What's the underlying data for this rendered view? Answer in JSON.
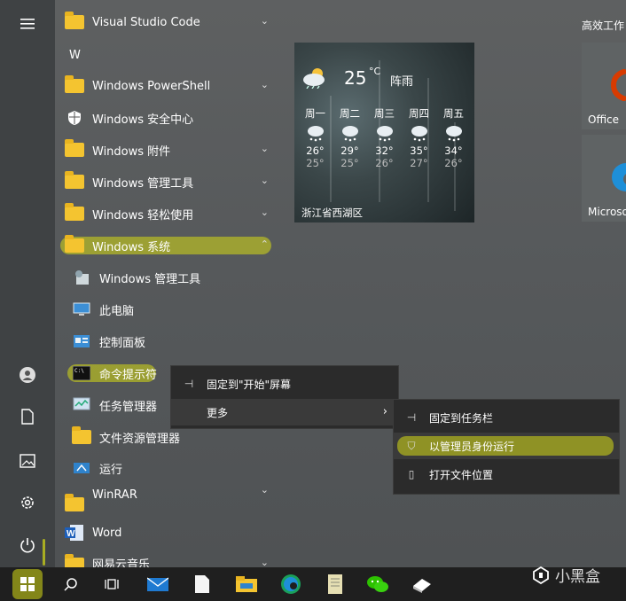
{
  "left_rail": {
    "menu_icon": "hamburger-icon",
    "user_icon": "user-icon",
    "document_icon": "document-icon",
    "pictures_icon": "pictures-icon",
    "settings_icon": "gear-icon",
    "power_icon": "power-icon"
  },
  "app_list": {
    "vscode": "Visual Studio Code",
    "letter_w": "W",
    "powershell": "Windows PowerShell",
    "security": "Windows 安全中心",
    "accessories": "Windows 附件",
    "admin_tools": "Windows 管理工具",
    "ease": "Windows 轻松使用",
    "system": "Windows 系统",
    "sub_admin": "Windows 管理工具",
    "this_pc": "此电脑",
    "control_panel": "控制面板",
    "cmd": "命令提示符",
    "task_manager": "任务管理器",
    "explorer": "文件资源管理器",
    "run": "运行",
    "winrar": "WinRAR",
    "word": "Word",
    "netease": "网易云音乐"
  },
  "weather": {
    "temp": "25",
    "unit": "°C",
    "condition": "阵雨",
    "days": [
      {
        "name": "周一",
        "high": "26°",
        "low": "25°"
      },
      {
        "name": "周二",
        "high": "29°",
        "low": "25°"
      },
      {
        "name": "周三",
        "high": "32°",
        "low": "26°"
      },
      {
        "name": "周四",
        "high": "35°",
        "low": "27°"
      },
      {
        "name": "周五",
        "high": "34°",
        "low": "26°"
      }
    ],
    "location": "浙江省西湖区"
  },
  "right_tiles": {
    "header": "高效工作",
    "office": "Office",
    "microsoft": "Microso"
  },
  "context_menu": {
    "pin_start": "固定到\"开始\"屏幕",
    "more": "更多"
  },
  "submenu": {
    "pin_taskbar": "固定到任务栏",
    "run_admin": "以管理员身份运行",
    "open_location": "打开文件位置"
  },
  "watermark": "小黑盒",
  "colors": {
    "highlight": "#d6db14",
    "folder": "#f4c430"
  }
}
